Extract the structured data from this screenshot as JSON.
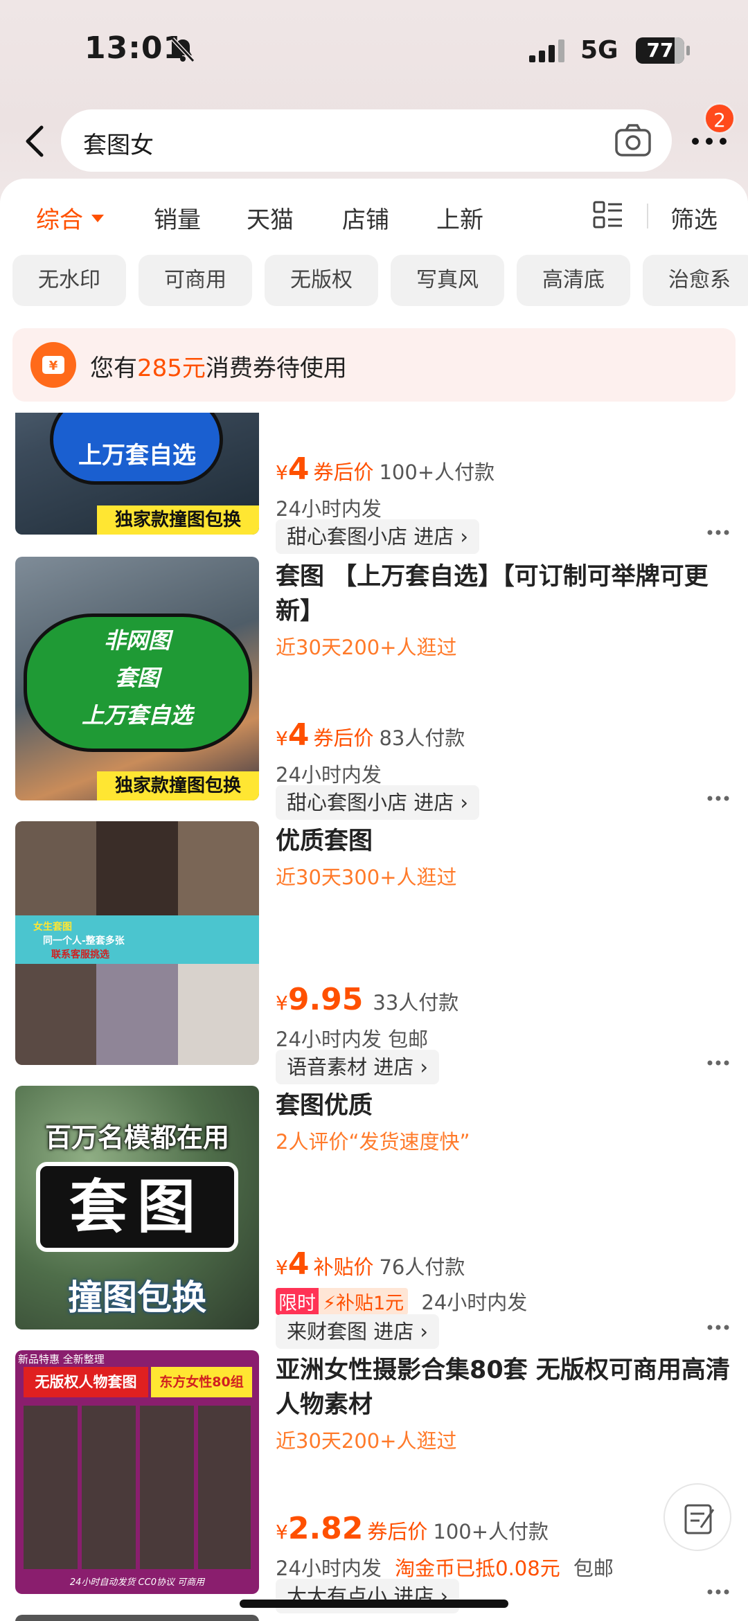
{
  "status": {
    "time": "13:01",
    "network": "5G",
    "battery": "77"
  },
  "search": {
    "query": "套图女",
    "badge_count": "2"
  },
  "tabs": [
    {
      "label": "综合",
      "active": true
    },
    {
      "label": "销量"
    },
    {
      "label": "天猫"
    },
    {
      "label": "店铺"
    },
    {
      "label": "上新"
    }
  ],
  "filter_label": "筛选",
  "chips": [
    "无水印",
    "可商用",
    "无版权",
    "写真风",
    "高清底",
    "治愈系"
  ],
  "coupon": {
    "prefix": "您有",
    "amount": "285元",
    "suffix": "消费券待使用",
    "icon": "yen-icon"
  },
  "products": [
    {
      "thumb_text": [
        "上万套自选",
        "独家款撞图包换"
      ],
      "price": "4",
      "price_label": "券后价",
      "sold": "100+人付款",
      "ship": "24小时内发",
      "shop": "甜心套图小店 进店"
    },
    {
      "title": "套图 【上万套自选】【可订制可举牌可更新】",
      "sub": "近30天200+人逛过",
      "thumb_text": [
        "非网图",
        "套图",
        "上万套自选",
        "独家款撞图包换"
      ],
      "price": "4",
      "price_label": "券后价",
      "sold": "83人付款",
      "ship": "24小时内发",
      "shop": "甜心套图小店 进店"
    },
    {
      "title": "优质套图",
      "sub": "近30天300+人逛过",
      "thumb_text": [
        "女生套图",
        "同一个人-整套多张",
        "联系客服挑选"
      ],
      "price": "9.95",
      "price_label": "",
      "sold": "33人付款",
      "ship": "24小时内发  包邮",
      "shop": "语音素材 进店"
    },
    {
      "title": "套图优质",
      "sub": "2人评价“发货速度快”",
      "thumb_text": [
        "百万名模都在用",
        "套图",
        "撞图包换"
      ],
      "price": "4",
      "price_label": "补贴价",
      "sold": "76人付款",
      "tag_a": "限时",
      "tag_b": "补贴1元",
      "ship": "24小时内发",
      "shop": "来财套图 进店"
    },
    {
      "title": "亚洲女性摄影合集80套 无版权可商用高清人物素材",
      "sub": "近30天200+人逛过",
      "thumb_text": [
        "新品特惠 全新整理",
        "无版权人物套图",
        "东方女性80组",
        "24小时自动发货  CC0协议  可商用"
      ],
      "price": "2.82",
      "price_label": "券后价",
      "sold": "100+人付款",
      "ship": "24小时内发",
      "ship_extra": "淘金币已抵0.08元",
      "ship_tail": "包邮",
      "shop": "大大有点小 进店"
    }
  ]
}
